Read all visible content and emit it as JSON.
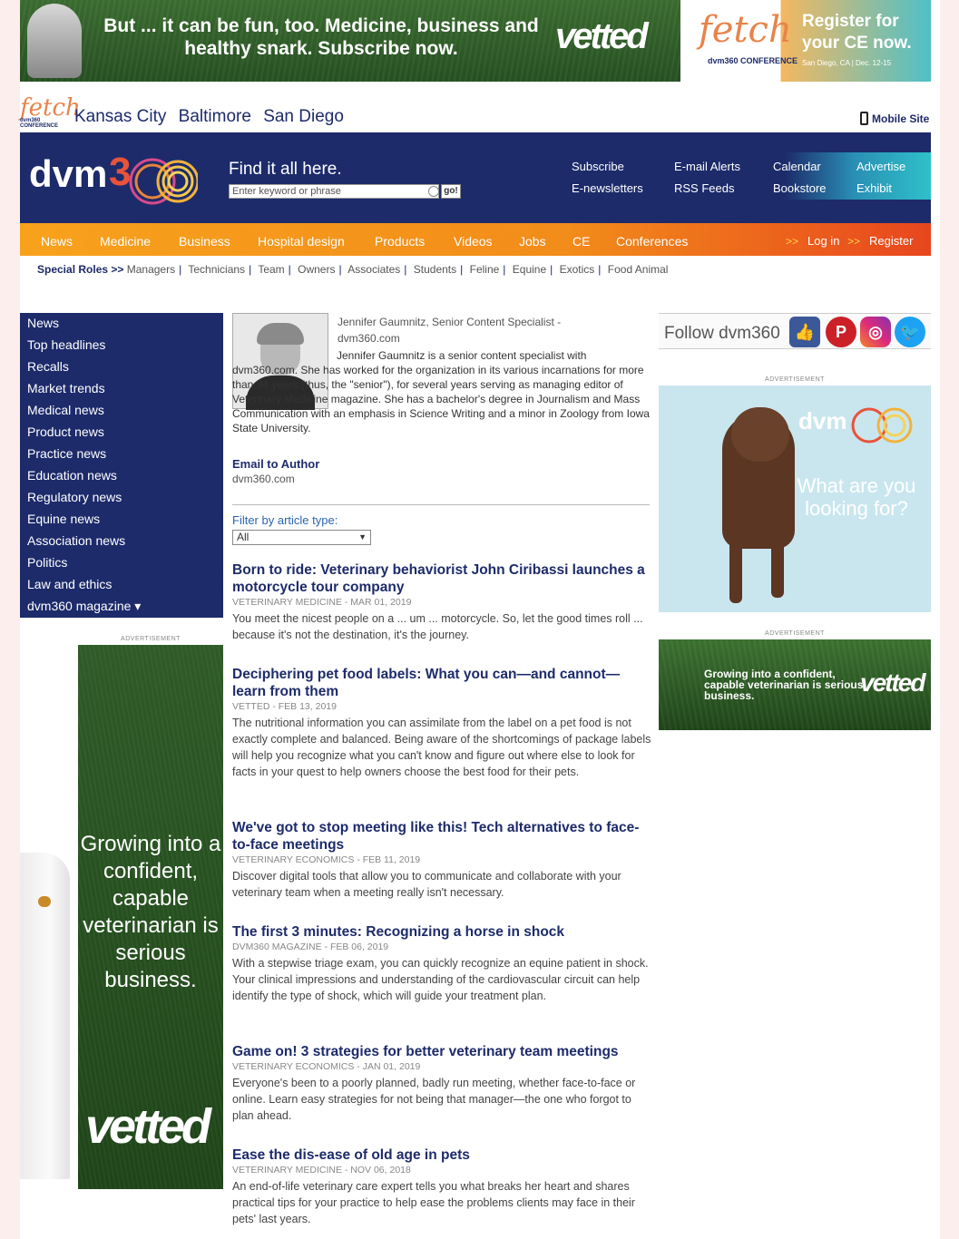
{
  "banners": {
    "top_left_text": "But ... it can be fun, too. Medicine, business and healthy snark. Subscribe now.",
    "top_left_brand": "vetted",
    "top_right_logo": "fetch",
    "top_right_logo_sub": "dvm360 CONFERENCE",
    "top_right_text": "Register for your CE now.",
    "top_right_location": "San Diego, CA | Dec. 12-15"
  },
  "city_bar": {
    "logo": "fetch",
    "logo_sub": "dvm360 CONFERENCE",
    "cities": [
      "Kansas City",
      "Baltimore",
      "San Diego"
    ],
    "mobile_site": "Mobile Site"
  },
  "header": {
    "logo": "dvm",
    "tagline": "Find it all here.",
    "search_placeholder": "Enter keyword or phrase",
    "go_label": "go!",
    "links": [
      "Subscribe",
      "E-mail Alerts",
      "Calendar",
      "Advertise",
      "E-newsletters",
      "RSS Feeds",
      "Bookstore",
      "Exhibit"
    ]
  },
  "nav": {
    "items": [
      "News",
      "Medicine",
      "Business",
      "Hospital design",
      "Products",
      "Videos",
      "Jobs",
      "CE",
      "Conferences"
    ],
    "login": "Log in",
    "register": "Register",
    "arrows": ">>"
  },
  "roles": {
    "label": "Special Roles >>",
    "items": [
      "Managers",
      "Technicians",
      "Team",
      "Owners",
      "Associates",
      "Students",
      "Feline",
      "Equine",
      "Exotics",
      "Food Animal"
    ]
  },
  "sidebar": {
    "items": [
      "News",
      "Top headlines",
      "Recalls",
      "Market trends",
      "Medical news",
      "Product news",
      "Practice news",
      "Education news",
      "Regulatory news",
      "Equine news",
      "Association news",
      "Politics",
      "Law and ethics",
      "dvm360 magazine ▾"
    ],
    "ad_label": "ADVERTISEMENT",
    "ad_text": "Growing into a confident, capable veterinarian is serious business.",
    "ad_brand": "vetted"
  },
  "author": {
    "name_line": "Jennifer Gaumnitz, Senior Content Specialist - dvm360.com",
    "bio": "Jennifer Gaumnitz is a senior content specialist with dvm360.com. She has worked for the organization in its various incarnations for more than 34 years (thus, the \"senior\"), for several years serving as managing editor of Veterinary Medicine magazine. She has a bachelor's degree in Journalism and Mass Communication with an emphasis in Science Writing and a minor in Zoology from Iowa State University.",
    "email_label": "Email to Author",
    "site": "dvm360.com"
  },
  "filter": {
    "label": "Filter by article type:",
    "selected": "All"
  },
  "articles": [
    {
      "title": "Born to ride: Veterinary behaviorist John Ciribassi launches a motorcycle tour company",
      "meta": "VETERINARY MEDICINE - Mar 01, 2019",
      "summary": "You meet the nicest people on a ... um ... motorcycle. So, let the good times roll ... because it's not the destination, it's the journey."
    },
    {
      "title": "Deciphering pet food labels: What you can—and cannot—learn from them",
      "meta": "VETTED - Feb 13, 2019",
      "summary": "The nutritional information you can assimilate from the label on a pet food is not exactly complete and balanced. Being aware of the shortcomings of package labels will help you recognize what you can't know and figure out where else to look for facts in your quest to help owners choose the best food for their pets."
    },
    {
      "title": "We've got to stop meeting like this! Tech alternatives to face-to-face meetings",
      "meta": "VETERINARY ECONOMICS - Feb 11, 2019",
      "summary": "Discover digital tools that allow you to communicate and collaborate with your veterinary team when a meeting really isn't necessary."
    },
    {
      "title": "The first 3 minutes: Recognizing a horse in shock",
      "meta": "DVM360 MAGAZINE - Feb 06, 2019",
      "summary": "With a stepwise triage exam, you can quickly recognize an equine patient in shock. Your clinical impressions and understanding of the cardiovascular circuit can help identify the type of shock, which will guide your treatment plan."
    },
    {
      "title": "Game on! 3 strategies for better veterinary team meetings",
      "meta": "VETERINARY ECONOMICS - Jan 01, 2019",
      "summary": "Everyone's been to a poorly planned, badly run meeting, whether face-to-face or online. Learn easy strategies for not being that manager—the one who forgot to plan ahead."
    },
    {
      "title": "Ease the dis-ease of old age in pets",
      "meta": "VETERINARY MEDICINE - Nov 06, 2018",
      "summary": "An end-of-life veterinary care expert tells you what breaks her heart and shares practical tips for your practice to help ease the problems clients may face in their pets' last years."
    }
  ],
  "right": {
    "follow": "Follow dvm360",
    "ad_label": "ADVERTISEMENT",
    "dog_ad_logo": "dvm",
    "dog_ad_text": "What are you looking for?",
    "grass_ad_text": "Growing into a confident, capable veterinarian is serious business.",
    "grass_ad_brand": "vetted"
  },
  "colors": {
    "navy": "#1d2b6b",
    "orange": "#f8a21c",
    "red_orange": "#e8461e",
    "teal": "#2fc0c9",
    "grass_green": "#2f5d2a"
  }
}
